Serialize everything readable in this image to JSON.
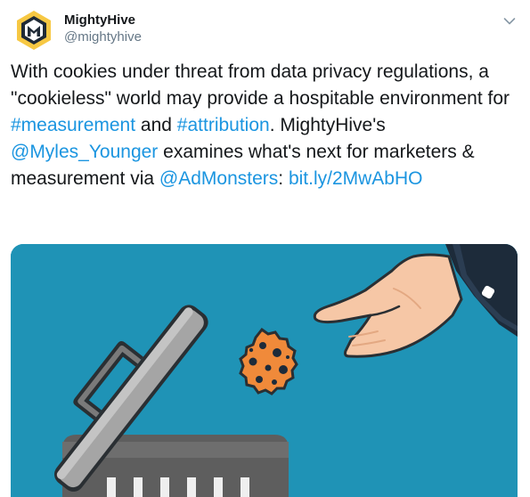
{
  "author": {
    "display_name": "MightyHive",
    "handle": "@mightyhive",
    "avatar_icon": "mightyhive-logo-icon",
    "logo_letter": "M"
  },
  "menu": {
    "icon": "chevron-down-icon"
  },
  "tweet": {
    "segments": [
      {
        "text": "With cookies under threat from data privacy regulations, a \"cookieless\" world may provide a hospitable environment for ",
        "link": false
      },
      {
        "text": "#measurement",
        "link": true
      },
      {
        "text": " and ",
        "link": false
      },
      {
        "text": "#attribution",
        "link": true
      },
      {
        "text": ". MightyHive's ",
        "link": false
      },
      {
        "text": "@Myles_Younger",
        "link": true
      },
      {
        "text": " examines what's next for marketers & measurement via ",
        "link": false
      },
      {
        "text": "@AdMonsters",
        "link": true
      },
      {
        "text": ": ",
        "link": false
      },
      {
        "text": "bit.ly/2MwAbHO",
        "link": true
      }
    ]
  },
  "media": {
    "description_icons": [
      "trash-can-icon",
      "cookie-icon",
      "hand-icon"
    ],
    "colors": {
      "background": "#1f93b6",
      "cookie": "#f08a3a",
      "skin": "#f6c7a6",
      "sleeve": "#1d2b3a",
      "can": "#6b6b6b",
      "lid": "#9a9a9a"
    }
  },
  "colors": {
    "link": "#1b95e0",
    "text": "#14171a",
    "muted": "#657786",
    "logo_yellow": "#f7c843",
    "logo_dark": "#1f2a36"
  }
}
